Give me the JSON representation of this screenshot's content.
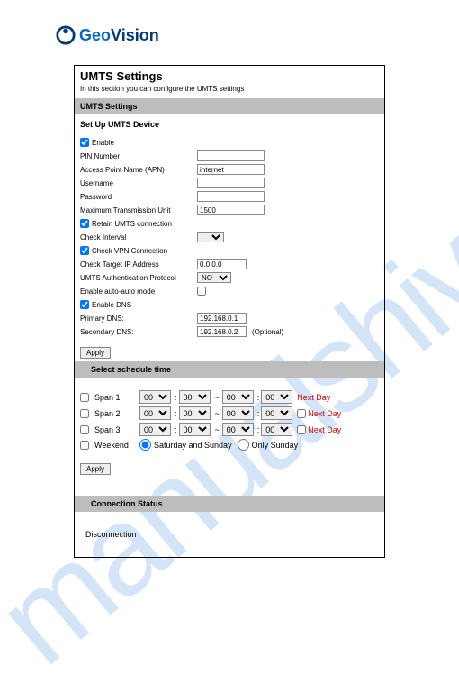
{
  "logo": {
    "brand_geo": "Geo",
    "brand_vision": "Vision"
  },
  "title": "UMTS Settings",
  "subtitle": "In this section you can configure the UMTS settings",
  "section1": "UMTS Settings",
  "setup_label": "Set Up UMTS Device",
  "form": {
    "enable": "Enable",
    "pin": "PIN Number",
    "apn_label": "Access Point Name (APN)",
    "apn_value": "internet",
    "username": "Username",
    "password": "Password",
    "mtu_label": "Maximum Transmission Unit",
    "mtu_value": "1500",
    "retain": "Retain UMTS connection",
    "check_interval": "Check Interval",
    "check_vpn": "Check VPN Connection",
    "check_target_label": "Check Target IP Address",
    "check_target_value": "0.0.0.0",
    "auth_label": "UMTS Authentication Protocol",
    "auth_value": "NO",
    "autoauto_label": "Enable auto-auto mode",
    "enable_dns": "Enable DNS",
    "primary_dns_label": "Primary DNS:",
    "primary_dns_value": "192.168.0.1",
    "secondary_dns_label": "Secondary DNS:",
    "secondary_dns_value": "192.168.0.2",
    "optional": "(Optional)",
    "apply": "Apply"
  },
  "section2": "Select schedule time",
  "schedule": {
    "span1": "Span 1",
    "span2": "Span 2",
    "span3": "Span 3",
    "weekend": "Weekend",
    "val": "00",
    "nextday": "Next Day",
    "sat_sun": "Saturday and Sunday",
    "only_sun": "Only Sunday",
    "apply": "Apply"
  },
  "section3": "Connection Status",
  "status": "Disconnection",
  "watermark": "manualshive.com"
}
